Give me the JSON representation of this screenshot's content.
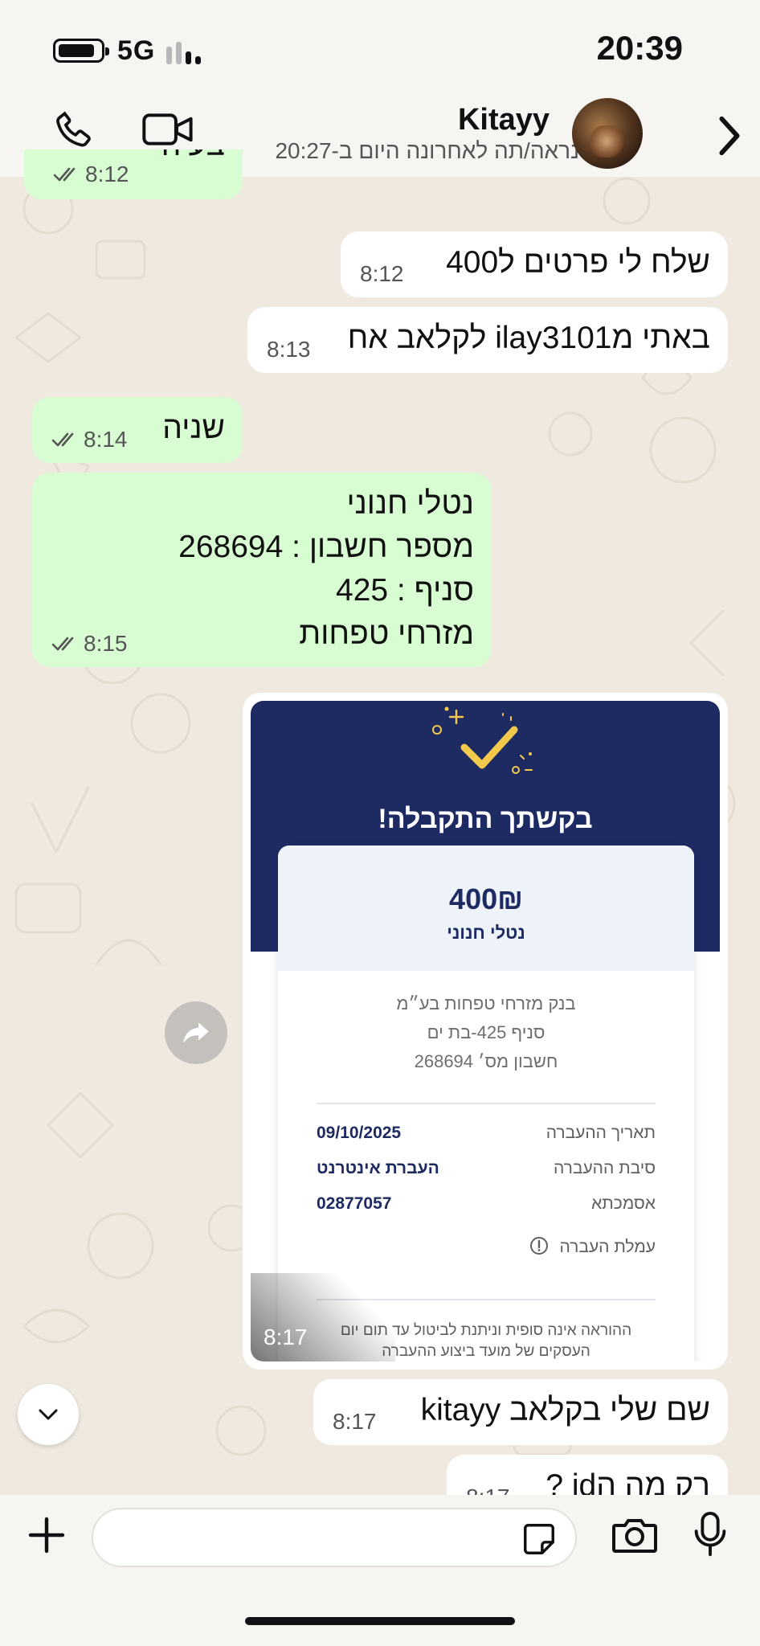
{
  "status_bar": {
    "network": "5G",
    "time": "20:39"
  },
  "header": {
    "contact_name": "Kitayy",
    "last_seen": "נראה/תה לאחרונה היום ב-20:27"
  },
  "messages": [
    {
      "id": "m0",
      "direction": "outgoing",
      "text": "בעיה",
      "time": "8:12",
      "status": "read"
    },
    {
      "id": "m1",
      "direction": "incoming",
      "text": "שלח לי פרטים ל400",
      "time": "8:12"
    },
    {
      "id": "m2",
      "direction": "incoming",
      "text": "באתי מilay3101 לקלאב אח",
      "time": "8:13"
    },
    {
      "id": "m3",
      "direction": "outgoing",
      "text": "שניה",
      "time": "8:14",
      "status": "read"
    },
    {
      "id": "m4",
      "direction": "outgoing",
      "lines": [
        "נטלי חנוני",
        "מספר חשבון : 268694",
        "סניף : 425",
        "מזרחי טפחות"
      ],
      "time": "8:15",
      "status": "read"
    },
    {
      "id": "m6",
      "direction": "incoming",
      "text": "שם שלי בקלאב kitayy",
      "time": "8:17"
    },
    {
      "id": "m7",
      "direction": "incoming",
      "text": "רק מה הid ?",
      "time": "8:17"
    }
  ],
  "receipt": {
    "time": "8:17",
    "title": "בקשתך התקבלה!",
    "amount": "400₪",
    "payee": "נטלי חנוני",
    "bank_lines": [
      "בנק מזרחי טפחות בע״מ",
      "סניף 425-בת ים",
      "חשבון מס׳ 268694"
    ],
    "rows": [
      {
        "label": "תאריך ההעברה",
        "value": "09/10/2025"
      },
      {
        "label": "סיבת ההעברה",
        "value": "העברת אינטרנט"
      },
      {
        "label": "אסמכתא",
        "value": "02877057"
      }
    ],
    "fee_label": "עמלת העברה",
    "note_lines": [
      "ההוראה אינה סופית וניתנת לביטול עד תום יום",
      "העסקים של מועד ביצוע ההעברה"
    ]
  },
  "composer": {
    "placeholder": ""
  },
  "colors": {
    "outgoing_bubble": "#d9fdd3",
    "incoming_bubble": "#ffffff",
    "receipt_navy": "#1e2a62",
    "check_yellow": "#f2c94c",
    "read_ticks": "#555555"
  },
  "icons": [
    "phone-icon",
    "video-camera-icon",
    "chevron-right-icon",
    "forward-icon",
    "chevron-down-icon",
    "plus-icon",
    "sticker-icon",
    "camera-icon",
    "microphone-icon",
    "double-check-icon"
  ]
}
